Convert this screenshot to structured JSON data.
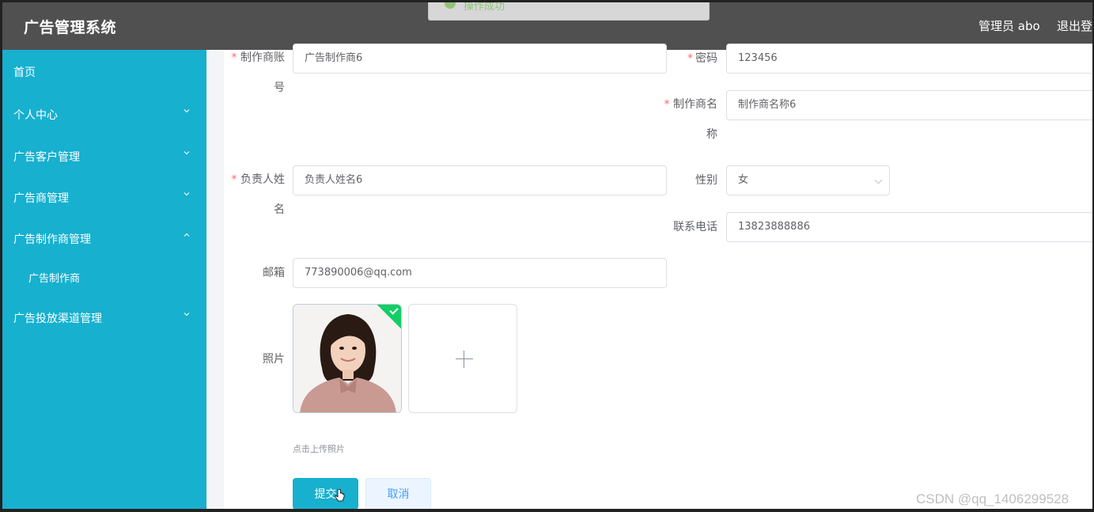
{
  "header": {
    "title": "广告管理系统",
    "user_label": "管理员 abo",
    "logout_label": "退出登",
    "toast_text": "操作成功"
  },
  "sidebar": {
    "items": [
      {
        "label": "首页"
      },
      {
        "label": "个人中心"
      },
      {
        "label": "广告客户管理"
      },
      {
        "label": "广告商管理"
      },
      {
        "label": "广告制作商管理"
      },
      {
        "label": "广告制作商"
      },
      {
        "label": "广告投放渠道管理"
      }
    ]
  },
  "form": {
    "account": {
      "label_line1": "制作商账",
      "label_line2": "号",
      "value": "广告制作商6"
    },
    "password": {
      "label": "密码",
      "value": "123456"
    },
    "maker_name": {
      "label_line1": "制作商名",
      "label_line2": "称",
      "value": "制作商名称6"
    },
    "manager_name": {
      "label_line1": "负责人姓",
      "label_line2": "名",
      "value": "负责人姓名6"
    },
    "gender": {
      "label": "性别",
      "value": "女"
    },
    "phone": {
      "label": "联系电话",
      "value": "13823888886"
    },
    "email": {
      "label": "邮箱",
      "value": "773890006@qq.com"
    },
    "photo": {
      "label": "照片",
      "hint": "点击上传照片"
    },
    "required_mark": "*",
    "submit_label": "提交",
    "cancel_label": "取消"
  },
  "watermark": "CSDN @qq_1406299528",
  "colors": {
    "header_bg": "#505050",
    "sidebar_bg": "#17b0cf",
    "primary": "#17b0cf",
    "required": "#f56c6c",
    "success": "#13ce66"
  }
}
